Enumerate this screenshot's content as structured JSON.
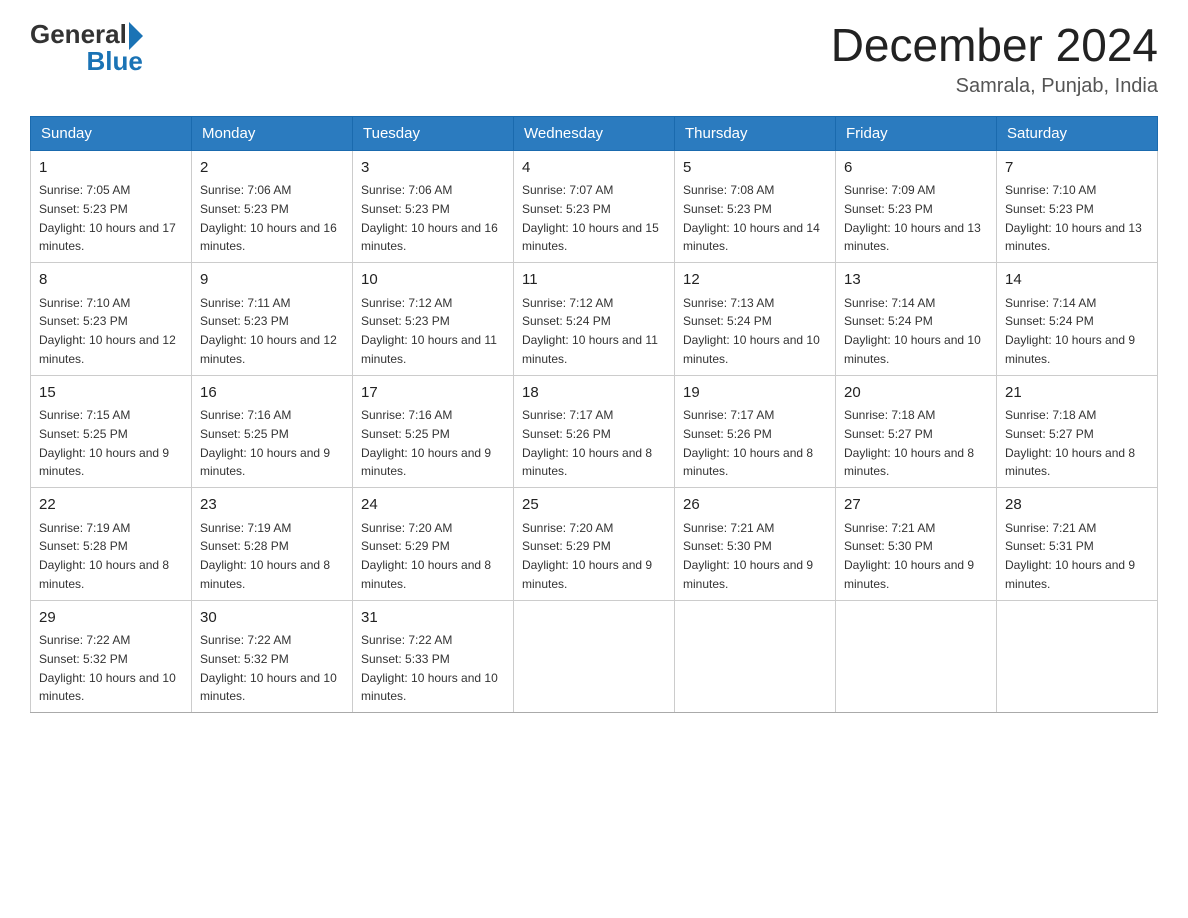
{
  "header": {
    "logo_general": "General",
    "logo_blue": "Blue",
    "title": "December 2024",
    "subtitle": "Samrala, Punjab, India"
  },
  "weekdays": [
    "Sunday",
    "Monday",
    "Tuesday",
    "Wednesday",
    "Thursday",
    "Friday",
    "Saturday"
  ],
  "weeks": [
    [
      {
        "day": "1",
        "sunrise": "7:05 AM",
        "sunset": "5:23 PM",
        "daylight": "10 hours and 17 minutes."
      },
      {
        "day": "2",
        "sunrise": "7:06 AM",
        "sunset": "5:23 PM",
        "daylight": "10 hours and 16 minutes."
      },
      {
        "day": "3",
        "sunrise": "7:06 AM",
        "sunset": "5:23 PM",
        "daylight": "10 hours and 16 minutes."
      },
      {
        "day": "4",
        "sunrise": "7:07 AM",
        "sunset": "5:23 PM",
        "daylight": "10 hours and 15 minutes."
      },
      {
        "day": "5",
        "sunrise": "7:08 AM",
        "sunset": "5:23 PM",
        "daylight": "10 hours and 14 minutes."
      },
      {
        "day": "6",
        "sunrise": "7:09 AM",
        "sunset": "5:23 PM",
        "daylight": "10 hours and 13 minutes."
      },
      {
        "day": "7",
        "sunrise": "7:10 AM",
        "sunset": "5:23 PM",
        "daylight": "10 hours and 13 minutes."
      }
    ],
    [
      {
        "day": "8",
        "sunrise": "7:10 AM",
        "sunset": "5:23 PM",
        "daylight": "10 hours and 12 minutes."
      },
      {
        "day": "9",
        "sunrise": "7:11 AM",
        "sunset": "5:23 PM",
        "daylight": "10 hours and 12 minutes."
      },
      {
        "day": "10",
        "sunrise": "7:12 AM",
        "sunset": "5:23 PM",
        "daylight": "10 hours and 11 minutes."
      },
      {
        "day": "11",
        "sunrise": "7:12 AM",
        "sunset": "5:24 PM",
        "daylight": "10 hours and 11 minutes."
      },
      {
        "day": "12",
        "sunrise": "7:13 AM",
        "sunset": "5:24 PM",
        "daylight": "10 hours and 10 minutes."
      },
      {
        "day": "13",
        "sunrise": "7:14 AM",
        "sunset": "5:24 PM",
        "daylight": "10 hours and 10 minutes."
      },
      {
        "day": "14",
        "sunrise": "7:14 AM",
        "sunset": "5:24 PM",
        "daylight": "10 hours and 9 minutes."
      }
    ],
    [
      {
        "day": "15",
        "sunrise": "7:15 AM",
        "sunset": "5:25 PM",
        "daylight": "10 hours and 9 minutes."
      },
      {
        "day": "16",
        "sunrise": "7:16 AM",
        "sunset": "5:25 PM",
        "daylight": "10 hours and 9 minutes."
      },
      {
        "day": "17",
        "sunrise": "7:16 AM",
        "sunset": "5:25 PM",
        "daylight": "10 hours and 9 minutes."
      },
      {
        "day": "18",
        "sunrise": "7:17 AM",
        "sunset": "5:26 PM",
        "daylight": "10 hours and 8 minutes."
      },
      {
        "day": "19",
        "sunrise": "7:17 AM",
        "sunset": "5:26 PM",
        "daylight": "10 hours and 8 minutes."
      },
      {
        "day": "20",
        "sunrise": "7:18 AM",
        "sunset": "5:27 PM",
        "daylight": "10 hours and 8 minutes."
      },
      {
        "day": "21",
        "sunrise": "7:18 AM",
        "sunset": "5:27 PM",
        "daylight": "10 hours and 8 minutes."
      }
    ],
    [
      {
        "day": "22",
        "sunrise": "7:19 AM",
        "sunset": "5:28 PM",
        "daylight": "10 hours and 8 minutes."
      },
      {
        "day": "23",
        "sunrise": "7:19 AM",
        "sunset": "5:28 PM",
        "daylight": "10 hours and 8 minutes."
      },
      {
        "day": "24",
        "sunrise": "7:20 AM",
        "sunset": "5:29 PM",
        "daylight": "10 hours and 8 minutes."
      },
      {
        "day": "25",
        "sunrise": "7:20 AM",
        "sunset": "5:29 PM",
        "daylight": "10 hours and 9 minutes."
      },
      {
        "day": "26",
        "sunrise": "7:21 AM",
        "sunset": "5:30 PM",
        "daylight": "10 hours and 9 minutes."
      },
      {
        "day": "27",
        "sunrise": "7:21 AM",
        "sunset": "5:30 PM",
        "daylight": "10 hours and 9 minutes."
      },
      {
        "day": "28",
        "sunrise": "7:21 AM",
        "sunset": "5:31 PM",
        "daylight": "10 hours and 9 minutes."
      }
    ],
    [
      {
        "day": "29",
        "sunrise": "7:22 AM",
        "sunset": "5:32 PM",
        "daylight": "10 hours and 10 minutes."
      },
      {
        "day": "30",
        "sunrise": "7:22 AM",
        "sunset": "5:32 PM",
        "daylight": "10 hours and 10 minutes."
      },
      {
        "day": "31",
        "sunrise": "7:22 AM",
        "sunset": "5:33 PM",
        "daylight": "10 hours and 10 minutes."
      },
      null,
      null,
      null,
      null
    ]
  ],
  "labels": {
    "sunrise": "Sunrise: ",
    "sunset": "Sunset: ",
    "daylight": "Daylight: "
  }
}
